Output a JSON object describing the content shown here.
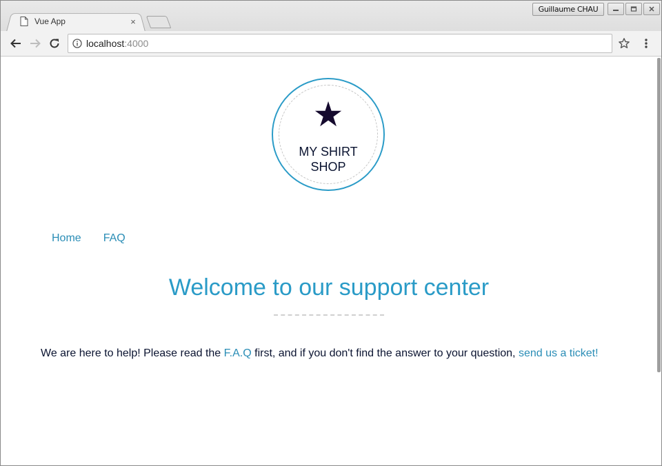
{
  "browser": {
    "tab_title": "Vue App",
    "tab_close": "×",
    "user_name": "Guillaume CHAU",
    "url_host": "localhost",
    "url_port": ":4000"
  },
  "icons": {
    "page": "page-icon",
    "back": "back-arrow-icon",
    "forward": "forward-arrow-icon",
    "reload": "reload-icon",
    "info": "info-icon",
    "bookmark": "star-icon",
    "menu": "kebab-menu-icon",
    "minimize": "minimize-icon",
    "maximize": "maximize-icon",
    "close": "close-icon"
  },
  "logo": {
    "symbol": "★",
    "line1": "MY SHIRT",
    "line2": "SHOP"
  },
  "nav": {
    "items": [
      {
        "label": "Home"
      },
      {
        "label": "FAQ"
      }
    ]
  },
  "main": {
    "title": "Welcome to our support center",
    "intro_before": "We are here to help! Please read the ",
    "faq_link": "F.A.Q",
    "intro_middle": " first, and if you don't find the answer to your question, ",
    "ticket_link": "send us a ticket!"
  },
  "colors": {
    "accent": "#2a9bc7",
    "link": "#2a8db6",
    "text": "#0a1330",
    "star": "#150a2e"
  }
}
